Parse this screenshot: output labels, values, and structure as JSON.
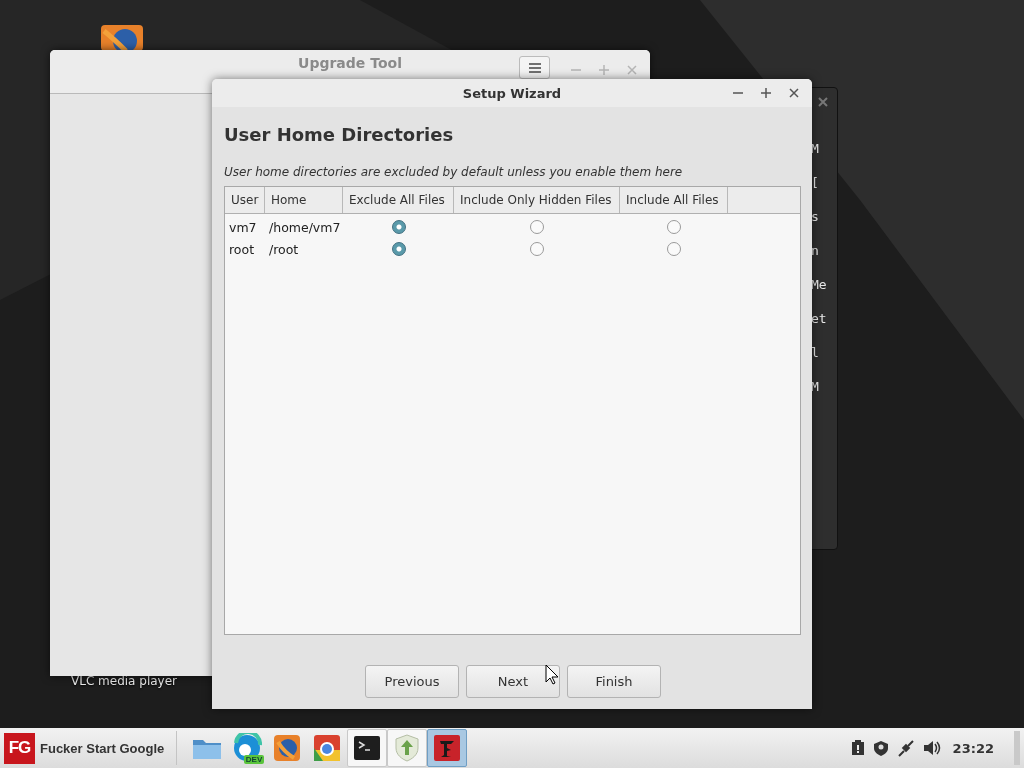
{
  "desktop": {
    "icon_labels": [
      "VLC media player"
    ]
  },
  "upgrade_tool": {
    "title": "Upgrade Tool"
  },
  "terminal": {
    "lines": [
      "M",
      "[",
      "s",
      "n",
      "Me",
      "et",
      "l",
      "M"
    ]
  },
  "setup_wizard": {
    "title": "Setup Wizard",
    "heading": "User Home Directories",
    "description": "User home directories are excluded by default unless you enable them here",
    "table": {
      "columns": [
        "User",
        "Home",
        "Exclude All Files",
        "Include Only Hidden Files",
        "Include All Files"
      ],
      "rows": [
        {
          "user": "vm7",
          "home": "/home/vm7",
          "choices": [
            {
              "selected": true
            },
            {
              "selected": false
            },
            {
              "selected": false
            }
          ]
        },
        {
          "user": "root",
          "home": "/root",
          "choices": [
            {
              "selected": true
            },
            {
              "selected": false
            },
            {
              "selected": false
            }
          ]
        }
      ]
    },
    "buttons": [
      "Previous",
      "Next",
      "Finish"
    ]
  },
  "taskbar": {
    "start": {
      "logo": "FG",
      "label": "Fucker Start Google"
    },
    "launchers": [
      {
        "kind": "folder",
        "open": false,
        "selected": false
      },
      {
        "kind": "edge",
        "badge": "DEV",
        "open": false,
        "selected": false
      },
      {
        "kind": "firefox",
        "open": false,
        "selected": false
      },
      {
        "kind": "chrome",
        "open": false,
        "selected": false
      },
      {
        "kind": "terminal",
        "open": true,
        "selected": false
      },
      {
        "kind": "updater",
        "open": true,
        "selected": false
      },
      {
        "kind": "app",
        "open": true,
        "selected": true
      }
    ],
    "clock": "23:22"
  }
}
